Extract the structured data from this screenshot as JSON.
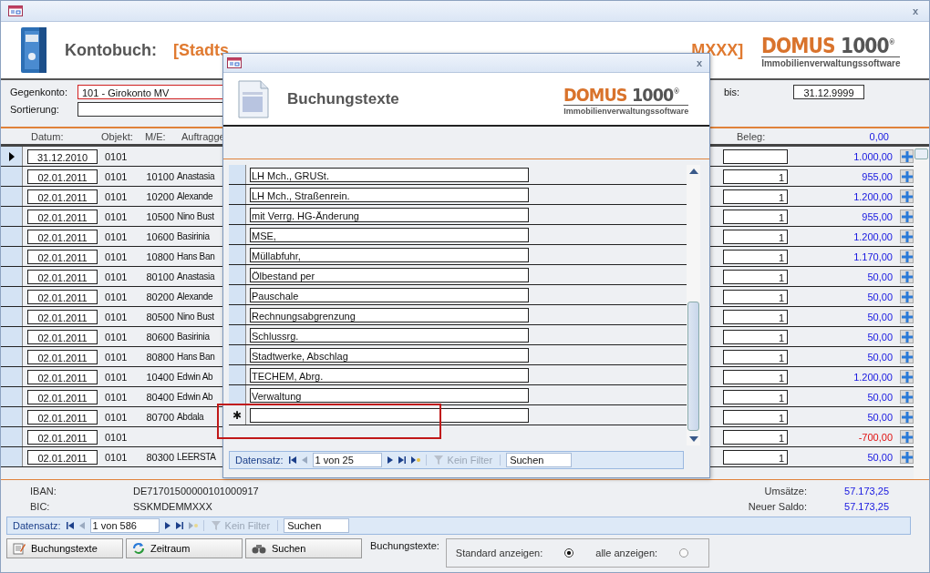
{
  "window": {
    "close": "x"
  },
  "header": {
    "title": "Kontobuch:",
    "subtitle_start": "[Stadts",
    "subtitle_end": "MXXX]",
    "logo": {
      "brand_a": "DOMUS",
      "brand_b": "1000",
      "reg": "®",
      "tagline": "Immobilienverwaltungssoftware"
    }
  },
  "filters": {
    "gegenkonto_label": "Gegenkonto:",
    "gegenkonto_value": "101 - Girokonto MV",
    "sortierung_label": "Sortierung:",
    "bis_label": "bis:",
    "bis_value": "31.12.9999"
  },
  "columns": {
    "datum": "Datum:",
    "objekt": "Objekt:",
    "me": "M/E:",
    "auftraggeber": "Auftragge",
    "beleg": "Beleg:",
    "opening": "0,00"
  },
  "rows": [
    {
      "datum": "31.12.2010",
      "objekt": "0101",
      "me": "",
      "auftraggeber": "",
      "beleg": "",
      "betrag": "1.000,00",
      "negative": false,
      "selected": true
    },
    {
      "datum": "02.01.2011",
      "objekt": "0101",
      "me": "10100",
      "auftraggeber": "Anastasia",
      "beleg": "1",
      "betrag": "955,00",
      "negative": false,
      "selected": false
    },
    {
      "datum": "02.01.2011",
      "objekt": "0101",
      "me": "10200",
      "auftraggeber": "Alexande",
      "beleg": "1",
      "betrag": "1.200,00",
      "negative": false,
      "selected": false
    },
    {
      "datum": "02.01.2011",
      "objekt": "0101",
      "me": "10500",
      "auftraggeber": "Nino Bust",
      "beleg": "1",
      "betrag": "955,00",
      "negative": false,
      "selected": false
    },
    {
      "datum": "02.01.2011",
      "objekt": "0101",
      "me": "10600",
      "auftraggeber": "Basirinia",
      "beleg": "1",
      "betrag": "1.200,00",
      "negative": false,
      "selected": false
    },
    {
      "datum": "02.01.2011",
      "objekt": "0101",
      "me": "10800",
      "auftraggeber": "Hans Ban",
      "beleg": "1",
      "betrag": "1.170,00",
      "negative": false,
      "selected": false
    },
    {
      "datum": "02.01.2011",
      "objekt": "0101",
      "me": "80100",
      "auftraggeber": "Anastasia",
      "beleg": "1",
      "betrag": "50,00",
      "negative": false,
      "selected": false
    },
    {
      "datum": "02.01.2011",
      "objekt": "0101",
      "me": "80200",
      "auftraggeber": "Alexande",
      "beleg": "1",
      "betrag": "50,00",
      "negative": false,
      "selected": false
    },
    {
      "datum": "02.01.2011",
      "objekt": "0101",
      "me": "80500",
      "auftraggeber": "Nino Bust",
      "beleg": "1",
      "betrag": "50,00",
      "negative": false,
      "selected": false
    },
    {
      "datum": "02.01.2011",
      "objekt": "0101",
      "me": "80600",
      "auftraggeber": "Basirinia",
      "beleg": "1",
      "betrag": "50,00",
      "negative": false,
      "selected": false
    },
    {
      "datum": "02.01.2011",
      "objekt": "0101",
      "me": "80800",
      "auftraggeber": "Hans Ban",
      "beleg": "1",
      "betrag": "50,00",
      "negative": false,
      "selected": false
    },
    {
      "datum": "02.01.2011",
      "objekt": "0101",
      "me": "10400",
      "auftraggeber": "Edwin Ab",
      "beleg": "1",
      "betrag": "1.200,00",
      "negative": false,
      "selected": false
    },
    {
      "datum": "02.01.2011",
      "objekt": "0101",
      "me": "80400",
      "auftraggeber": "Edwin Ab",
      "beleg": "1",
      "betrag": "50,00",
      "negative": false,
      "selected": false
    },
    {
      "datum": "02.01.2011",
      "objekt": "0101",
      "me": "80700",
      "auftraggeber": "Abdala",
      "beleg": "1",
      "betrag": "50,00",
      "negative": false,
      "selected": false
    },
    {
      "datum": "02.01.2011",
      "objekt": "0101",
      "me": "",
      "auftraggeber": "",
      "beleg": "1",
      "betrag": "-700,00",
      "negative": true,
      "selected": false
    },
    {
      "datum": "02.01.2011",
      "objekt": "0101",
      "me": "80300",
      "auftraggeber": "LEERSTA",
      "beleg": "1",
      "betrag": "50,00",
      "negative": false,
      "selected": false
    }
  ],
  "summary": {
    "iban_label": "IBAN:",
    "iban": "DE71701500000101000917",
    "bic_label": "BIC:",
    "bic": "SSKMDEMMXXX",
    "umsaetze_label": "Umsätze:",
    "umsaetze": "57.173,25",
    "saldo_label": "Neuer Saldo:",
    "saldo": "57.173,25"
  },
  "navigation": {
    "label": "Datensatz:",
    "position": "1 von 586",
    "filter": "Kein Filter",
    "search": "Suchen"
  },
  "buttons": [
    "Buchungstexte",
    "Zeitraum",
    "Suchen"
  ],
  "display_option": {
    "label": "Buchungstexte:",
    "options": [
      {
        "label": "Standard anzeigen:",
        "selected": true
      },
      {
        "label": "alle anzeigen:",
        "selected": false
      }
    ]
  },
  "dialog": {
    "close": "x",
    "title": "Buchungstexte",
    "logo": {
      "brand_a": "DOMUS",
      "brand_b": "1000",
      "reg": "®",
      "tagline": "Immobilienverwaltungssoftware"
    },
    "entries": [
      "LH Mch., GRUSt.",
      "LH Mch., Straßenrein.",
      "mit Verrg. HG-Änderung",
      "MSE,",
      "Müllabfuhr,",
      "Ölbestand per",
      "Pauschale",
      "Rechnungsabgrenzung",
      "Schlussrg.",
      "Stadtwerke, Abschlag",
      "TECHEM, Abrg.",
      "Verwaltung"
    ],
    "new_row_marker": "✱",
    "navigation": {
      "label": "Datensatz:",
      "position": "1 von 25",
      "filter": "Kein Filter",
      "search": "Suchen"
    }
  }
}
